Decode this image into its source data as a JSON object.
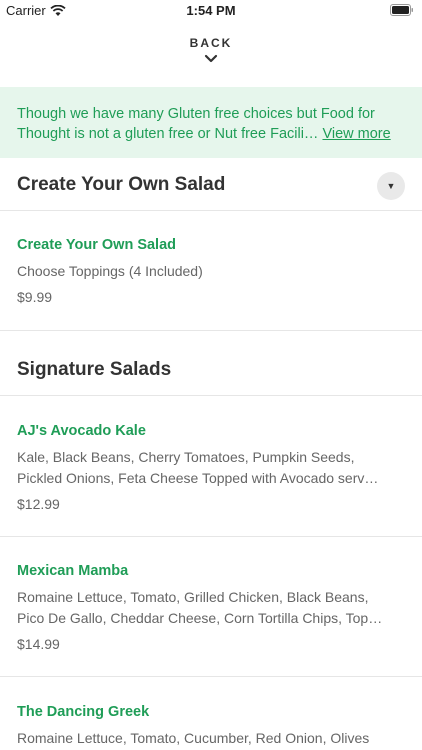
{
  "status_bar": {
    "carrier": "Carrier",
    "time": "1:54 PM"
  },
  "header": {
    "back_label": "BACK"
  },
  "notice": {
    "text": "Though we have many Gluten free choices but Food for Thought is not a gluten free or Nut free Facili…",
    "view_more": "View more"
  },
  "sections": [
    {
      "title": "Create Your Own Salad",
      "items": [
        {
          "name": "Create Your Own Salad",
          "description": "Choose Toppings (4 Included)",
          "price": "$9.99"
        }
      ]
    },
    {
      "title": "Signature Salads",
      "items": [
        {
          "name": "AJ's Avocado Kale",
          "description_line1": "Kale, Black Beans, Cherry Tomatoes, Pumpkin Seeds,",
          "description_line2": "Pickled Onions, Feta Cheese Topped with Avocado serv…",
          "price": "$12.99"
        },
        {
          "name": "Mexican Mamba",
          "description_line1": "Romaine Lettuce, Tomato, Grilled Chicken, Black Beans,",
          "description_line2": "Pico De Gallo, Cheddar Cheese, Corn Tortilla Chips, Top…",
          "price": "$14.99"
        },
        {
          "name": "The Dancing Greek",
          "description_line1": "Romaine Lettuce, Tomato, Cucumber, Red Onion, Olives"
        }
      ]
    }
  ],
  "colors": {
    "accent_green": "#1f9d57",
    "banner_bg": "#e6f6ec"
  }
}
